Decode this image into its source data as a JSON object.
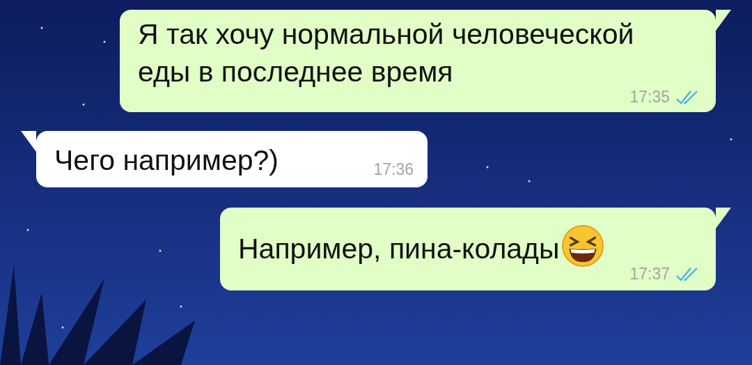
{
  "messages": [
    {
      "text": "Я так хочу нормальной человеческой еды в последнее время",
      "time": "17:35",
      "outgoing": true,
      "read": true,
      "emoji": false
    },
    {
      "text": "Чего например?)",
      "time": "17:36",
      "outgoing": false,
      "read": false,
      "emoji": false
    },
    {
      "text": "Например, пина-колады",
      "time": "17:37",
      "outgoing": true,
      "read": true,
      "emoji": true
    }
  ]
}
